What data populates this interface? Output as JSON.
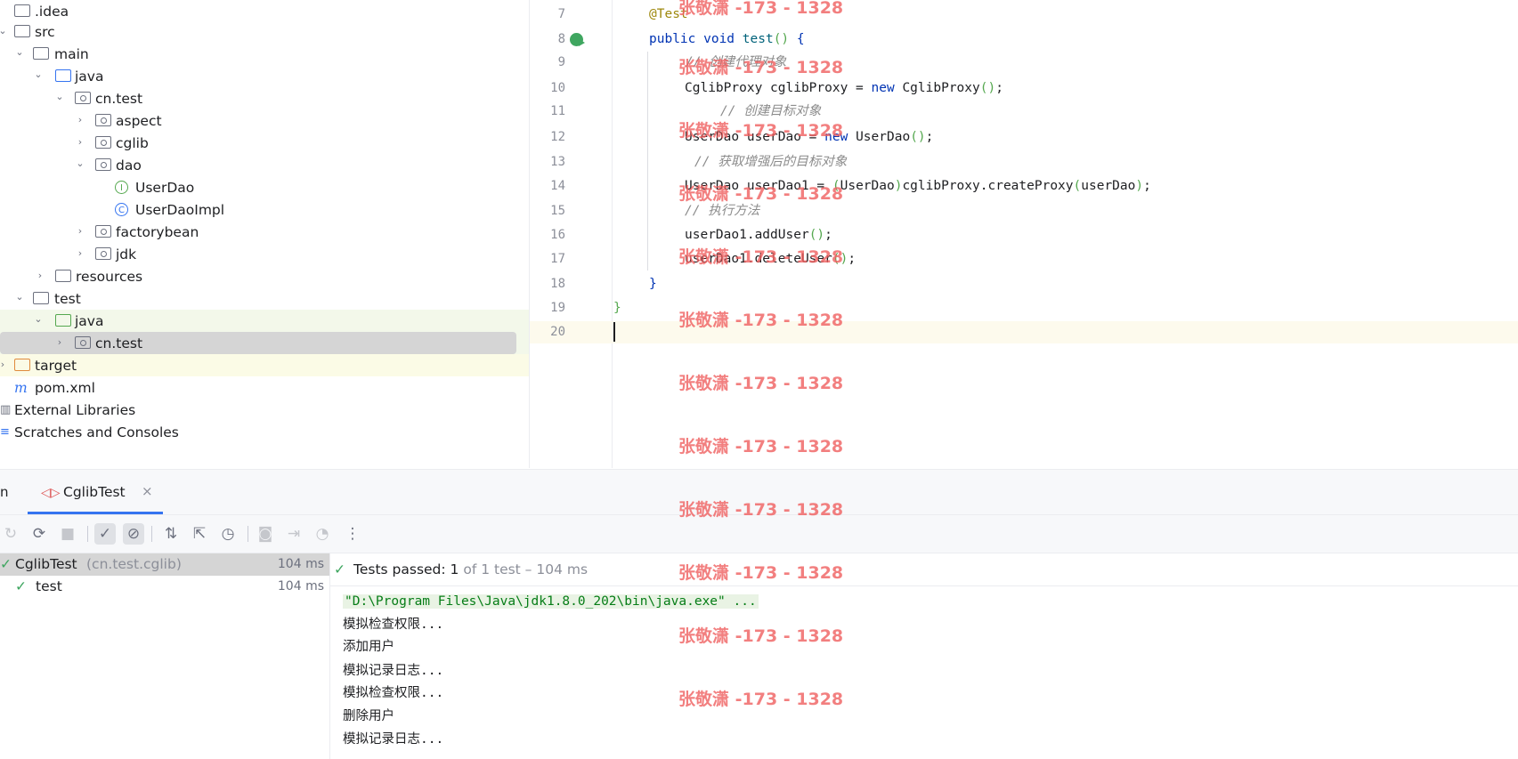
{
  "project_tree": [
    {
      "label": ".idea",
      "icon": "folder-icon",
      "expanded": null
    },
    {
      "label": "src",
      "icon": "folder-icon",
      "expanded": true
    },
    {
      "label": "main",
      "icon": "folder-icon",
      "expanded": true
    },
    {
      "label": "java",
      "icon": "source-folder-icon",
      "expanded": true
    },
    {
      "label": "cn.test",
      "icon": "package-icon",
      "expanded": true
    },
    {
      "label": "aspect",
      "icon": "package-icon",
      "expanded": false
    },
    {
      "label": "cglib",
      "icon": "package-icon",
      "expanded": false
    },
    {
      "label": "dao",
      "icon": "package-icon",
      "expanded": true
    },
    {
      "label": "UserDao",
      "icon": "interface-icon",
      "expanded": null
    },
    {
      "label": "UserDaoImpl",
      "icon": "class-icon",
      "expanded": null
    },
    {
      "label": "factorybean",
      "icon": "package-icon",
      "expanded": false
    },
    {
      "label": "jdk",
      "icon": "package-icon",
      "expanded": false
    },
    {
      "label": "resources",
      "icon": "resources-folder-icon",
      "expanded": false
    },
    {
      "label": "test",
      "icon": "folder-icon",
      "expanded": true
    },
    {
      "label": "java",
      "icon": "test-source-folder-icon",
      "expanded": true
    },
    {
      "label": "cn.test",
      "icon": "package-icon",
      "expanded": false
    },
    {
      "label": "target",
      "icon": "excluded-folder-icon",
      "expanded": false
    },
    {
      "label": "pom.xml",
      "icon": "maven-icon",
      "expanded": null
    },
    {
      "label": "External Libraries",
      "icon": "library-icon",
      "expanded": false
    },
    {
      "label": "Scratches and Consoles",
      "icon": "scratches-icon",
      "expanded": false
    }
  ],
  "editor": {
    "lines": [
      {
        "num": "7",
        "text": "@Test"
      },
      {
        "num": "8",
        "text": "public void test() {"
      },
      {
        "num": "9",
        "text": "// 创建代理对象"
      },
      {
        "num": "10",
        "text": "CglibProxy cglibProxy = new CglibProxy();"
      },
      {
        "num": "11",
        "text": "// 创建目标对象"
      },
      {
        "num": "12",
        "text": "UserDao userDao = new UserDao();"
      },
      {
        "num": "13",
        "text": "// 获取增强后的目标对象"
      },
      {
        "num": "14",
        "text": "UserDao userDao1 = (UserDao)cglibProxy.createProxy(userDao);"
      },
      {
        "num": "15",
        "text": "// 执行方法"
      },
      {
        "num": "16",
        "text": "userDao1.addUser();"
      },
      {
        "num": "17",
        "text": "userDao1.deleteUser();"
      },
      {
        "num": "18",
        "text": "}"
      },
      {
        "num": "19",
        "text": "}"
      },
      {
        "num": "20",
        "text": ""
      }
    ]
  },
  "run_panel": {
    "tab_prefix": "n",
    "tab_label": "CglibTest",
    "tests": [
      {
        "name": "CglibTest",
        "detail": "(cn.test.cglib)",
        "time": "104 ms"
      },
      {
        "name": "test",
        "detail": "",
        "time": "104 ms"
      }
    ],
    "status_bold": "Tests passed: 1",
    "status_rest": " of 1 test – 104 ms",
    "console": [
      "\"D:\\Program Files\\Java\\jdk1.8.0_202\\bin\\java.exe\" ...",
      "模拟检查权限...",
      "添加用户",
      "模拟记录日志...",
      "模拟检查权限...",
      "删除用户",
      "模拟记录日志..."
    ]
  },
  "watermark": "张敬潇 -173 - 1328"
}
